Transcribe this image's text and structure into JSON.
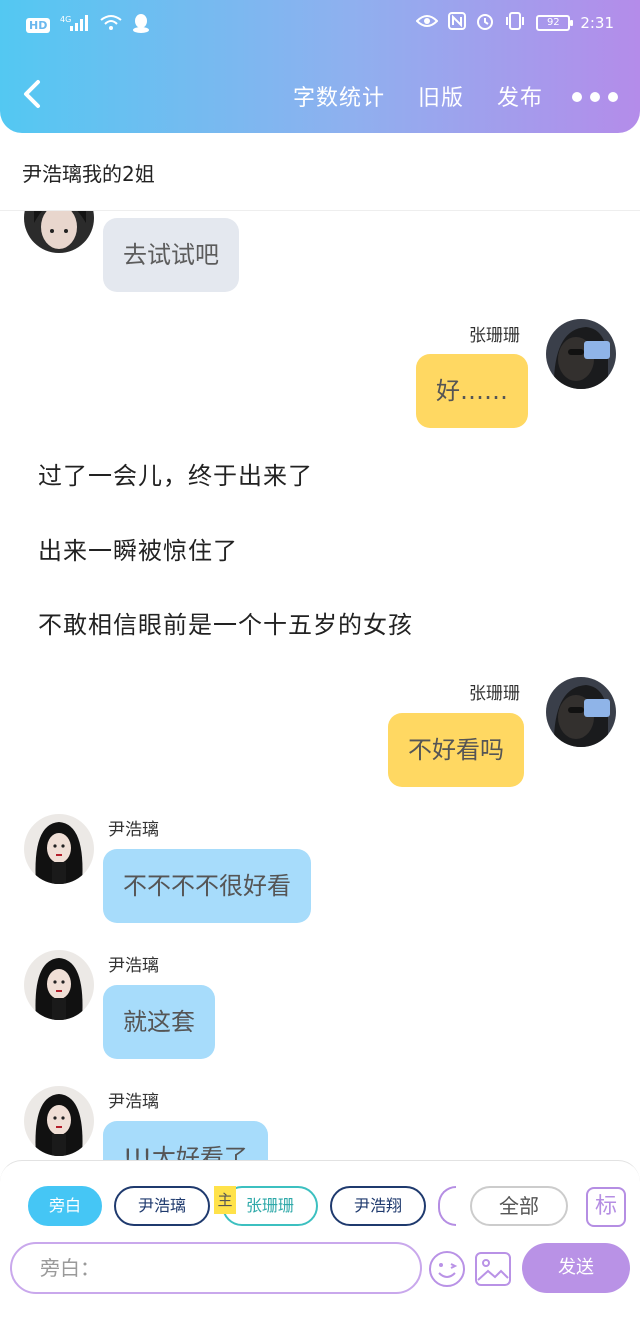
{
  "status_bar": {
    "network": "HD",
    "signal": "4G",
    "time": "2:31",
    "battery": "92"
  },
  "nav": {
    "word_count": "字数统计",
    "old_version": "旧版",
    "publish": "发布"
  },
  "story_title": "尹浩璃我的2姐",
  "messages": {
    "m1_text": "去试试吧",
    "m2_name": "张珊珊",
    "m2_text": "好……",
    "n1": "过了一会儿，终于出来了",
    "n2": "出来一瞬被惊住了",
    "n3": "不敢相信眼前是一个十五岁的女孩",
    "m3_name": "张珊珊",
    "m3_text": "不好看吗",
    "m4_name": "尹浩璃",
    "m4_text": "不不不不很好看",
    "m5_name": "尹浩璃",
    "m5_text": "就这套",
    "m6_name": "尹浩璃",
    "m6_text": "!!!太好看了"
  },
  "roles": {
    "aside": "旁白",
    "yin_haoli": "尹浩璃",
    "main_badge": "主",
    "zhang_shanshan": "张珊珊",
    "yin_haoxiang": "尹浩翔",
    "all": "全部",
    "tag": "标"
  },
  "composer": {
    "placeholder": "旁白：",
    "send": "发送"
  },
  "colors": {
    "header_start": "#53c8f2",
    "header_end": "#b48cea",
    "bubble_yellow": "#ffd862",
    "bubble_blue": "#a7dcfb",
    "bubble_gray": "#e4e8ef",
    "send": "#b992e6"
  }
}
